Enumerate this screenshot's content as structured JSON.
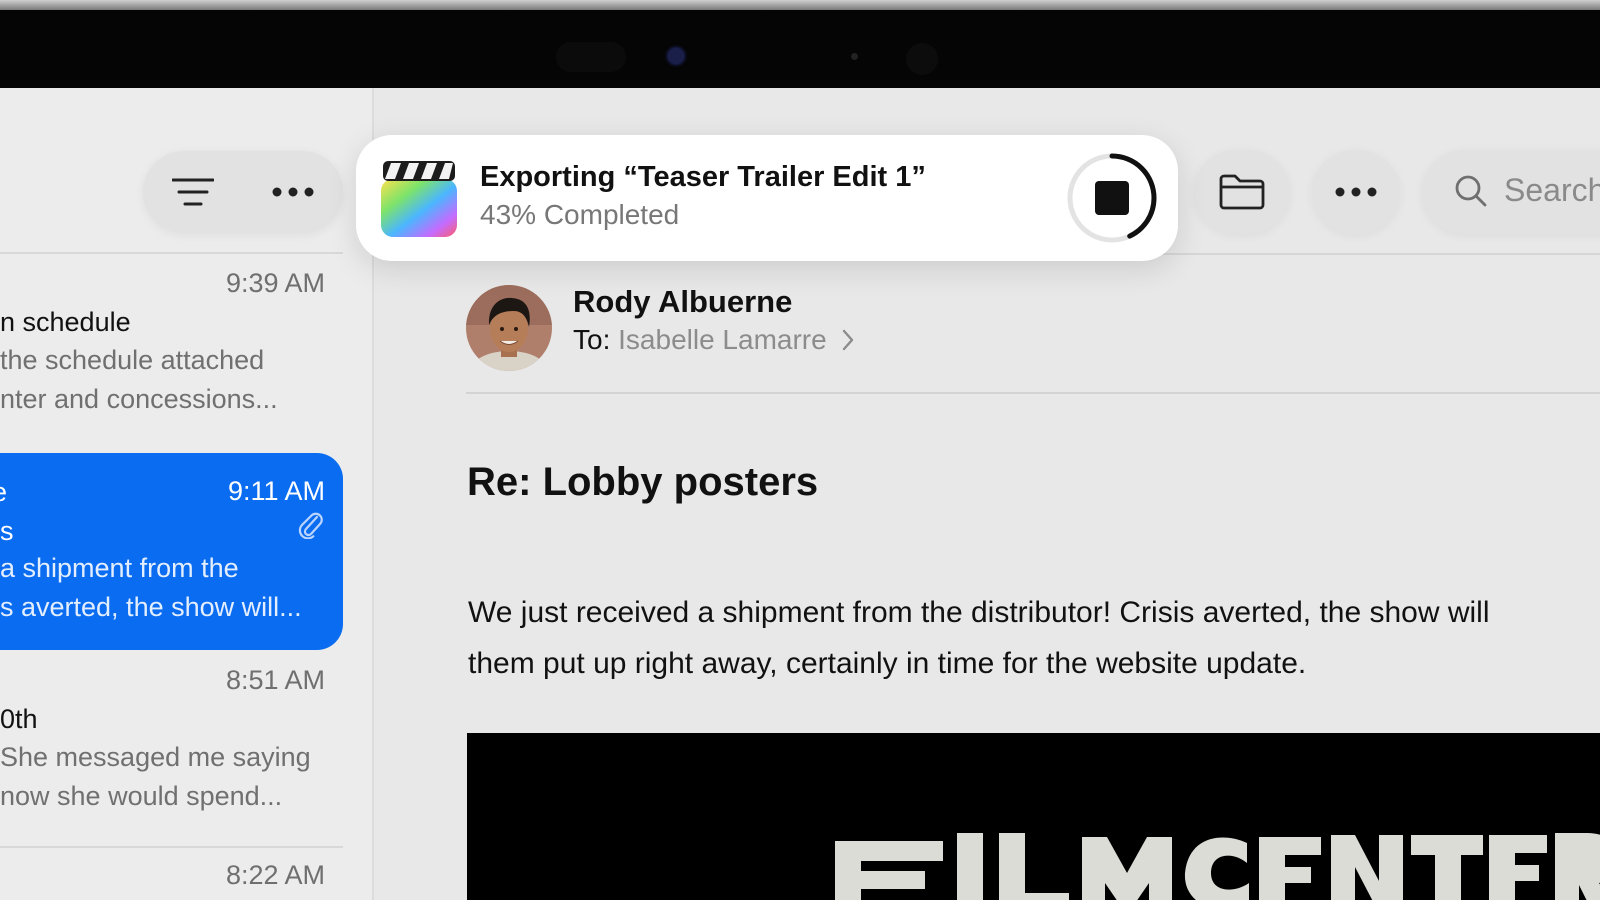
{
  "export_banner": {
    "title": "Exporting “Teaser Trailer Edit 1”",
    "status": "43% Completed",
    "progress": 0.43,
    "app_icon": "final-cut-pro-icon",
    "stop_icon": "stop-icon"
  },
  "toolbar": {
    "filter_icon": "filter-lines-icon",
    "more_icon": "ellipsis-icon",
    "folder_icon": "folder-icon",
    "search_placeholder": "Search"
  },
  "messages": [
    {
      "time": "9:39 AM",
      "subject": "n schedule",
      "preview": [
        "the schedule attached",
        "nter and concessions..."
      ],
      "selected": false
    },
    {
      "time": "9:11 AM",
      "subject": "s",
      "sender_fragment": "e",
      "preview": [
        "a shipment from the",
        "s averted, the show will..."
      ],
      "selected": true,
      "attachment": true
    },
    {
      "time": "8:51 AM",
      "subject": "0th",
      "preview": [
        "She messaged me saying",
        "now she would spend..."
      ],
      "selected": false
    },
    {
      "time": "8:22 AM"
    }
  ],
  "email": {
    "sender": "Rody Albuerne",
    "to_label": "To:",
    "to_name": "Isabelle Lamarre",
    "subject": "Re: Lobby posters",
    "body_line1": "We just received a shipment from the distributor! Crisis averted, the show will",
    "body_line2": "them put up right away, certainly in time for the website update.",
    "poster_text": "FILMCENTER"
  },
  "colors": {
    "accent": "#0a6cf0",
    "background": "#e8e8e8",
    "banner": "#ffffff"
  }
}
